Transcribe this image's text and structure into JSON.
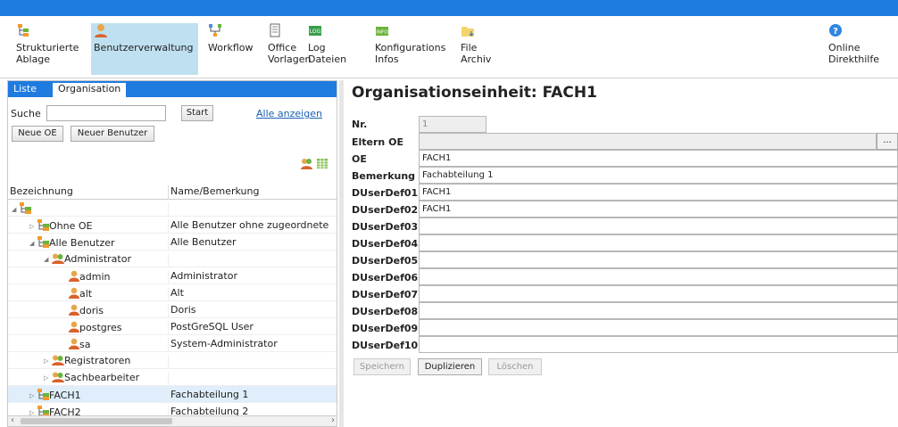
{
  "toolbar": {
    "items": [
      {
        "label": "Strukturierte\nAblage",
        "icon": "tree-structure-icon"
      },
      {
        "label": "Benutzerverwaltung",
        "icon": "user-icon"
      },
      {
        "label": "Workflow",
        "icon": "workflow-icon"
      },
      {
        "label": "Office\nVorlagen",
        "icon": "document-icon"
      },
      {
        "label": "Log\nDateien",
        "icon": "log-icon"
      },
      {
        "label": "Konfigurations\nInfos",
        "icon": "info-icon"
      },
      {
        "label": "File\nArchiv",
        "icon": "folder-icon"
      },
      {
        "label": "Online\nDirekthilfe",
        "icon": "help-icon"
      }
    ]
  },
  "left": {
    "tabs": [
      "Liste",
      "Organisation"
    ],
    "search_label": "Suche",
    "search_value": "",
    "start_button": "Start",
    "show_all_link": "Alle anzeigen",
    "new_oe_button": "Neue OE",
    "new_user_button": "Neuer Benutzer",
    "columns": [
      "Bezeichnung",
      "Name/Bemerkung"
    ],
    "rows": [
      {
        "name": "",
        "desc": ""
      },
      {
        "name": "Ohne OE",
        "desc": "Alle Benutzer ohne zugeordnete"
      },
      {
        "name": "Alle Benutzer",
        "desc": "Alle Benutzer"
      },
      {
        "name": "Administrator",
        "desc": ""
      },
      {
        "name": "admin",
        "desc": "Administrator"
      },
      {
        "name": "alt",
        "desc": "Alt"
      },
      {
        "name": "doris",
        "desc": "Doris"
      },
      {
        "name": "postgres",
        "desc": "PostGreSQL User"
      },
      {
        "name": "sa",
        "desc": "System-Administrator"
      },
      {
        "name": "Registratoren",
        "desc": ""
      },
      {
        "name": "Sachbearbeiter",
        "desc": ""
      },
      {
        "name": "FACH1",
        "desc": "Fachabteilung 1"
      },
      {
        "name": "FACH2",
        "desc": "Fachabteilung 2"
      }
    ]
  },
  "form": {
    "title": "Organisationseinheit: FACH1",
    "fields": [
      {
        "label": "Nr.",
        "value": "1"
      },
      {
        "label": "Eltern OE",
        "value": ""
      },
      {
        "label": "OE",
        "value": "FACH1"
      },
      {
        "label": "Bemerkung",
        "value": "Fachabteilung 1"
      },
      {
        "label": "DUserDef01",
        "value": "FACH1"
      },
      {
        "label": "DUserDef02",
        "value": "FACH1"
      },
      {
        "label": "DUserDef03",
        "value": ""
      },
      {
        "label": "DUserDef04",
        "value": ""
      },
      {
        "label": "DUserDef05",
        "value": ""
      },
      {
        "label": "DUserDef06",
        "value": ""
      },
      {
        "label": "DUserDef07",
        "value": ""
      },
      {
        "label": "DUserDef08",
        "value": ""
      },
      {
        "label": "DUserDef09",
        "value": ""
      },
      {
        "label": "DUserDef10",
        "value": ""
      }
    ],
    "browse_button": "...",
    "save_button": "Speichern",
    "duplicate_button": "Duplizieren",
    "delete_button": "Löschen"
  },
  "colors": {
    "accent": "#1e7be0",
    "selected": "#dfeefa",
    "active_tool": "#bfe0f0"
  }
}
